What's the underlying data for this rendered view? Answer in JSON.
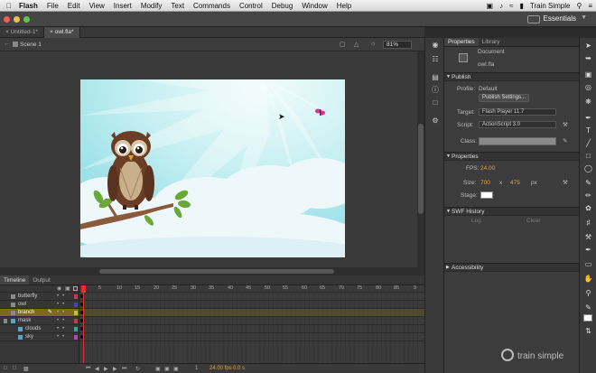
{
  "menubar": {
    "app_name": "Flash",
    "items": [
      "File",
      "Edit",
      "View",
      "Insert",
      "Modify",
      "Text",
      "Commands",
      "Control",
      "Debug",
      "Window",
      "Help"
    ],
    "right_label": "Train Simple"
  },
  "workspace": {
    "label": "Essentials"
  },
  "doc_tabs": [
    {
      "label": "Untitled-1*"
    },
    {
      "label": "owl.fla*"
    }
  ],
  "edit_bar": {
    "scene_label": "Scene 1",
    "zoom": "81%"
  },
  "timeline": {
    "tabs": [
      "Timeline",
      "Output"
    ],
    "ruler_ticks": [
      "1",
      "5",
      "10",
      "15",
      "20",
      "25",
      "30",
      "35",
      "40",
      "45",
      "50",
      "55",
      "60",
      "65",
      "70",
      "75",
      "80",
      "85",
      "9"
    ],
    "layers": [
      {
        "name": "butterfly",
        "selected": false,
        "color": "#c04040"
      },
      {
        "name": "owl",
        "selected": false,
        "color": "#4040c0"
      },
      {
        "name": "branch",
        "selected": true,
        "color": "#c0c040"
      },
      {
        "name": "mask",
        "selected": false,
        "color": "#c04040"
      },
      {
        "name": "clouds",
        "selected": false,
        "color": "#40a0a0"
      },
      {
        "name": "sky",
        "selected": false,
        "color": "#c040c0"
      }
    ],
    "status": {
      "frame": "1",
      "fps": "24.00 fps",
      "time": "0.0 s"
    }
  },
  "properties": {
    "tabs": [
      "Properties",
      "Library"
    ],
    "doc_type": "Document",
    "doc_name": "owl.fla",
    "publish": {
      "header": "Publish",
      "profile_label": "Profile:",
      "profile_value": "Default",
      "settings_button": "Publish Settings...",
      "target_label": "Target:",
      "target_value": "Flash Player 11.7",
      "script_label": "Script:",
      "script_value": "ActionScript 3.0",
      "class_label": "Class:"
    },
    "props": {
      "header": "Properties",
      "fps_label": "FPS:",
      "fps_value": "24.00",
      "size_label": "Size:",
      "width": "700",
      "x_label": "x",
      "height": "475",
      "unit": "px",
      "stage_label": "Stage:",
      "stage_color": "#ffffff"
    },
    "swf_history": {
      "header": "SWF History",
      "log_label": "Log",
      "clear_label": "Clear"
    },
    "accessibility": {
      "header": "Accessibility"
    }
  },
  "watermark": "train simple",
  "colors": {
    "sky_light": "#e3f7f8",
    "sky_mid": "#9fe3ea",
    "selected_layer": "#7a6a1a",
    "orange_value": "#e8a33a"
  }
}
